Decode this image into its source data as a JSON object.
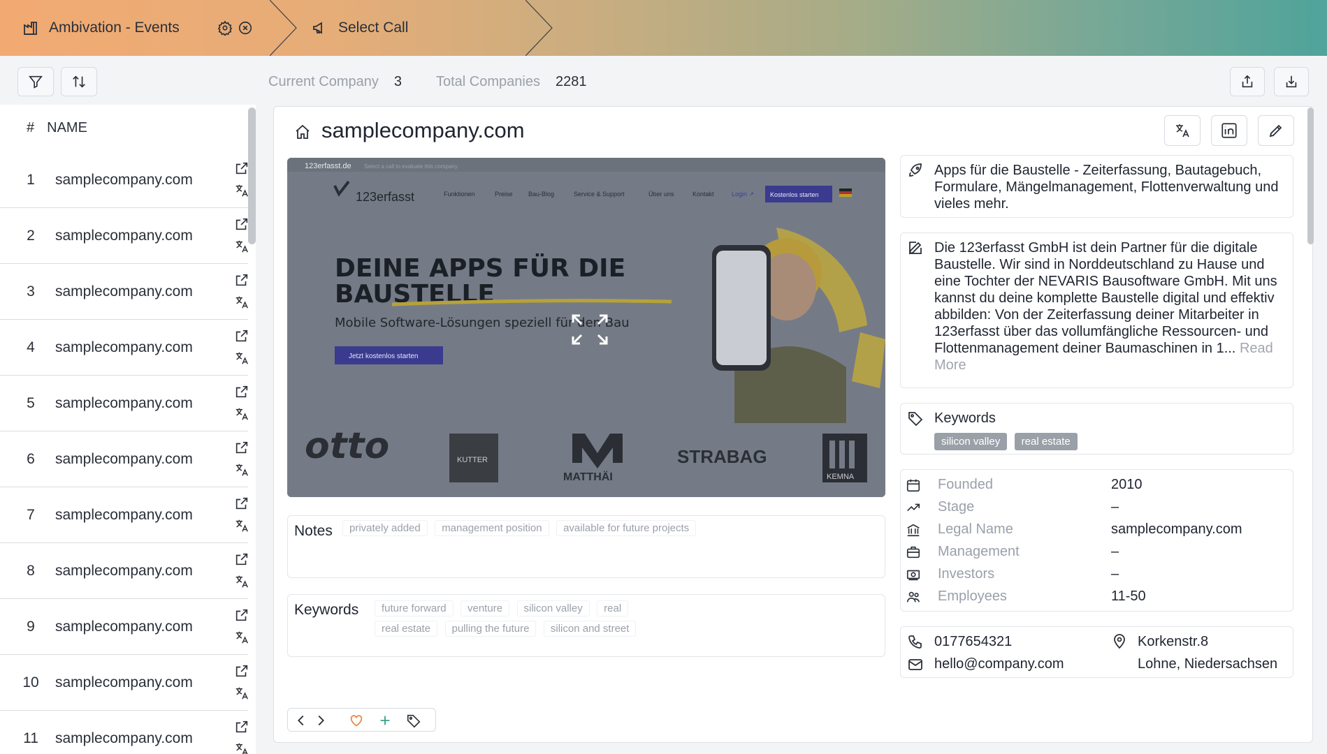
{
  "header": {
    "crumb1": "Ambivation - Events",
    "crumb2": "Select Call"
  },
  "stats": {
    "current_label": "Current Company",
    "current_value": "3",
    "total_label": "Total Companies",
    "total_value": "2281"
  },
  "sidebar": {
    "col_num": "#",
    "col_name": "NAME",
    "rows": [
      {
        "num": "1",
        "name": "samplecompany.com"
      },
      {
        "num": "2",
        "name": "samplecompany.com"
      },
      {
        "num": "3",
        "name": "samplecompany.com"
      },
      {
        "num": "4",
        "name": "samplecompany.com"
      },
      {
        "num": "5",
        "name": "samplecompany.com"
      },
      {
        "num": "6",
        "name": "samplecompany.com"
      },
      {
        "num": "7",
        "name": "samplecompany.com"
      },
      {
        "num": "8",
        "name": "samplecompany.com"
      },
      {
        "num": "9",
        "name": "samplecompany.com"
      },
      {
        "num": "10",
        "name": "samplecompany.com"
      },
      {
        "num": "11",
        "name": "samplecompany.com"
      }
    ]
  },
  "company": {
    "title": "samplecompany.com",
    "tagline": "Apps für die Baustelle - Zeiterfassung, Bautagebuch, Formulare, Mängelmanagement, Flottenverwaltung und vieles mehr.",
    "description": "Die 123erfasst GmbH ist dein Partner für die digitale Baustelle. Wir sind in Norddeutschland zu Hause und eine Tochter der NEVARIS Bausoftware GmbH. Mit uns kannst du deine komplette Baustelle digital und effektiv abbilden: Von der Zeiterfassung deiner Mitarbeiter in 123erfasst über das vollumfängliche Ressourcen- und Flottenmanagement deiner Baumaschinen in 1...",
    "read_more": "Read More",
    "keywords_label": "Keywords",
    "keywords": [
      "silicon valley",
      "real estate"
    ],
    "details": [
      {
        "label": "Founded",
        "value": "2010",
        "icon": "calendar-icon"
      },
      {
        "label": "Stage",
        "value": "–",
        "icon": "trend-icon"
      },
      {
        "label": "Legal Name",
        "value": "samplecompany.com",
        "icon": "bank-icon"
      },
      {
        "label": "Management",
        "value": "–",
        "icon": "briefcase-icon"
      },
      {
        "label": "Investors",
        "value": "–",
        "icon": "money-icon"
      },
      {
        "label": "Employees",
        "value": "11-50",
        "icon": "people-icon"
      }
    ],
    "phone": "0177654321",
    "email": "hello@company.com",
    "street": "Korkenstr.8",
    "city": "Lohne, Niedersachsen"
  },
  "preview": {
    "site_url": "123erfasst.de",
    "site_hint": "Select a call to evaluate this company",
    "logo": "123erfasst",
    "nav": [
      "Funktionen",
      "Preise",
      "Bau-Blog",
      "Service & Support",
      "Über uns",
      "Kontakt",
      "Login ↗"
    ],
    "cta": "Kostenlos starten",
    "headline1": "DEINE APPS FÜR DIE",
    "headline2": "BAUSTELLE",
    "subline": "Mobile Software-Lösungen speziell für den Bau",
    "button": "Jetzt kostenlos starten",
    "brands": [
      "otto",
      "KUTTER",
      "MATTHÄI",
      "STRABAG",
      "KEMNA"
    ]
  },
  "notes": {
    "label": "Notes",
    "chips": [
      "privately added",
      "management position",
      "available for future projects"
    ]
  },
  "keywords_box": {
    "label": "Keywords",
    "chips": [
      "future forward",
      "venture",
      "silicon valley",
      "real",
      "real estate",
      "pulling the future",
      "silicon and street"
    ]
  }
}
